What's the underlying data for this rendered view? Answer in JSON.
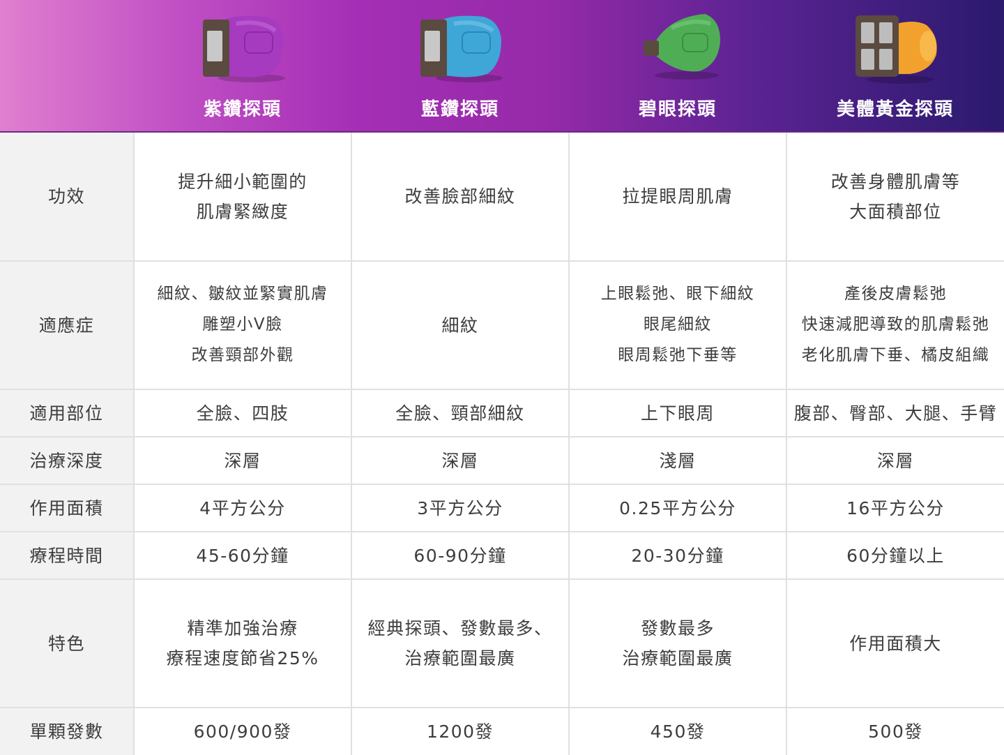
{
  "probes": [
    {
      "name": "紫鑽探頭",
      "icon": "purple-probe-icon",
      "color": "#a63bc0"
    },
    {
      "name": "藍鑽探頭",
      "icon": "blue-probe-icon",
      "color": "#3fa6d8"
    },
    {
      "name": "碧眼探頭",
      "icon": "green-probe-icon",
      "color": "#4fae55"
    },
    {
      "name": "美體黃金探頭",
      "icon": "gold-probe-icon",
      "color": "#f2a22c"
    }
  ],
  "rows": [
    {
      "label": "功效",
      "cells": [
        [
          "提升細小範圍的",
          "肌膚緊緻度"
        ],
        [
          "改善臉部細紋"
        ],
        [
          "拉提眼周肌膚"
        ],
        [
          "改善身體肌膚等",
          "大面積部位"
        ]
      ]
    },
    {
      "label": "適應症",
      "cells": [
        [
          "細紋、皺紋並緊實肌膚",
          "雕塑小V臉",
          "改善頸部外觀"
        ],
        [
          "細紋"
        ],
        [
          "上眼鬆弛、眼下細紋",
          "眼尾細紋",
          "眼周鬆弛下垂等"
        ],
        [
          "產後皮膚鬆弛",
          "快速減肥導致的肌膚鬆弛",
          "老化肌膚下垂、橘皮組織"
        ]
      ]
    },
    {
      "label": "適用部位",
      "cells": [
        [
          "全臉、四肢"
        ],
        [
          "全臉、頸部細紋"
        ],
        [
          "上下眼周"
        ],
        [
          "腹部、臀部、大腿、手臂"
        ]
      ]
    },
    {
      "label": "治療深度",
      "cells": [
        [
          "深層"
        ],
        [
          "深層"
        ],
        [
          "淺層"
        ],
        [
          "深層"
        ]
      ]
    },
    {
      "label": "作用面積",
      "cells": [
        [
          "4平方公分"
        ],
        [
          "3平方公分"
        ],
        [
          "0.25平方公分"
        ],
        [
          "16平方公分"
        ]
      ]
    },
    {
      "label": "療程時間",
      "cells": [
        [
          "45-60分鐘"
        ],
        [
          "60-90分鐘"
        ],
        [
          "20-30分鐘"
        ],
        [
          "60分鐘以上"
        ]
      ]
    },
    {
      "label": "特色",
      "cells": [
        [
          "精準加強治療",
          "療程速度節省25%"
        ],
        [
          "經典探頭、發數最多、",
          "治療範圍最廣"
        ],
        [
          "發數最多",
          "治療範圍最廣"
        ],
        [
          "作用面積大"
        ]
      ]
    },
    {
      "label": "單顆發數",
      "cells": [
        [
          "600/900發"
        ],
        [
          "1200發"
        ],
        [
          "450發"
        ],
        [
          "500發"
        ]
      ]
    }
  ]
}
